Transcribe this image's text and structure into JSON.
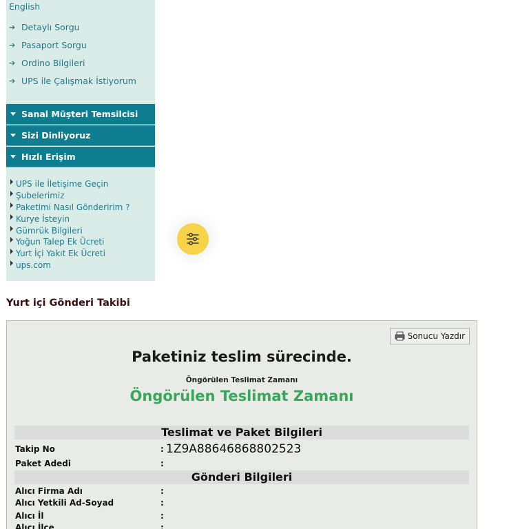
{
  "sidebar": {
    "language_link": "English",
    "quick_links": [
      "Detaylı Sorgu",
      "Pasaport Sorgu",
      "Ordino Bilgileri",
      "UPS ile Çalışmak İstiyorum"
    ],
    "accordion": [
      "Sanal Müşteri Temsilcisi",
      "Sizi Dinliyoruz",
      "Hızlı Erişim"
    ],
    "quick_access_links": [
      "UPS ile İletişime Geçin",
      "Şubelerimiz",
      "Paketimi Nasıl Gönderirim ?",
      "Kurye İsteyin",
      "Gümrük Bilgileri",
      "Yoğun Talep Ek Ücreti",
      "Yurt İçi Yakıt Ek Ücreti",
      "ups.com"
    ]
  },
  "fab": {
    "icon": "sliders-icon",
    "color": "#f7d34a"
  },
  "tracking": {
    "section_title": "Yurt içi Gönderi Takibi",
    "print_button": "Sonucu Yazdır",
    "status_message": "Paketiniz teslim sürecinde.",
    "eta_label": "Öngörülen Teslimat Zamanı",
    "eta_value": "Öngörülen Teslimat Zamanı",
    "delivery_section_title": "Teslimat ve Paket Bilgileri",
    "tracking_no_label": "Takip No",
    "tracking_no_value": "1Z9A88646868802523",
    "package_count_label": "Paket Adedi",
    "package_count_value": "",
    "shipment_section_title": "Gönderi Bilgileri",
    "recipient_company_label": "Alıcı Firma Adı",
    "recipient_contact_label": "Alıcı Yetkili Ad-Soyad",
    "recipient_city_label": "Alıcı İl",
    "recipient_district_label": "Alıcı İlçe"
  },
  "colors": {
    "sidebar_bg": "#d9ece8",
    "accordion_bg": "#0e7d8f",
    "link": "#1f7a8c",
    "eta_green": "#3aa65a",
    "title_brown": "#3b0f0f"
  }
}
